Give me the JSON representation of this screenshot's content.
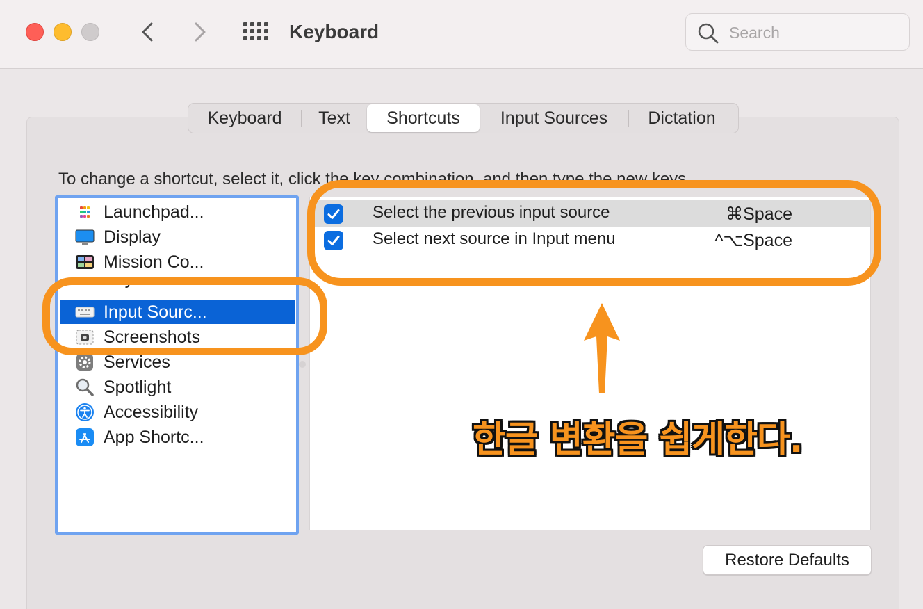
{
  "window": {
    "title": "Keyboard",
    "search_placeholder": "Search"
  },
  "tabs": [
    {
      "label": "Keyboard",
      "active": false
    },
    {
      "label": "Text",
      "active": false
    },
    {
      "label": "Shortcuts",
      "active": true
    },
    {
      "label": "Input Sources",
      "active": false
    },
    {
      "label": "Dictation",
      "active": false
    }
  ],
  "instruction": "To change a shortcut, select it, click the key combination, and then type the new keys.",
  "categories": [
    {
      "label": "Launchpad...",
      "icon": "launchpad-icon",
      "selected": false
    },
    {
      "label": "Display",
      "icon": "display-icon",
      "selected": false
    },
    {
      "label": "Mission Co...",
      "icon": "mission-control-icon",
      "selected": false
    },
    {
      "label": "Keyboard",
      "icon": "keyboard-icon",
      "selected": false
    },
    {
      "label": "Input Sourc...",
      "icon": "keyboard-icon",
      "selected": true
    },
    {
      "label": "Screenshots",
      "icon": "screenshot-icon",
      "selected": false
    },
    {
      "label": "Services",
      "icon": "gear-icon",
      "selected": false
    },
    {
      "label": "Spotlight",
      "icon": "magnifier-icon",
      "selected": false
    },
    {
      "label": "Accessibility",
      "icon": "accessibility-icon",
      "selected": false
    },
    {
      "label": "App Shortc...",
      "icon": "app-store-icon",
      "selected": false
    }
  ],
  "shortcuts": [
    {
      "checked": true,
      "label": "Select the previous input source",
      "keys": "⌘Space",
      "highlighted": true
    },
    {
      "checked": true,
      "label": "Select next source in Input menu",
      "keys": "^⌥Space",
      "highlighted": false
    }
  ],
  "restore_defaults_label": "Restore Defaults",
  "annotation": {
    "text": "한글 변환을 쉽게한다.",
    "color": "#f7931e"
  }
}
